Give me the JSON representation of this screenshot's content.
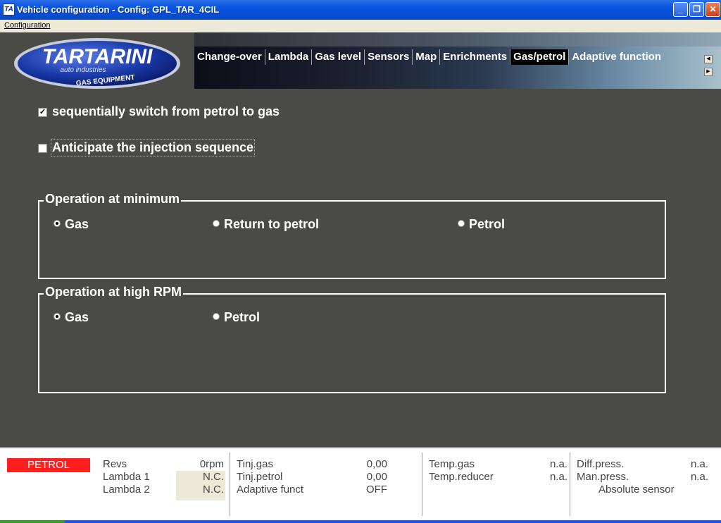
{
  "window": {
    "title": "Vehicle configuration - Config: GPL_TAR_4CIL",
    "icon": "app-icon",
    "controls": [
      "minimize",
      "restore",
      "close"
    ]
  },
  "menubar": {
    "items": [
      "Configuration"
    ]
  },
  "logo": {
    "name": "TARTARINI",
    "tagline": "auto industries",
    "sub": "GAS EQUIPMENT"
  },
  "tabs": [
    "Change-over",
    "Lambda",
    "Gas level",
    "Sensors",
    "Map",
    "Enrichments",
    "Gas/petrol",
    "Adaptive function"
  ],
  "active_tab": "Gas/petrol",
  "options": {
    "sequential_switch": {
      "label": "sequentially switch from petrol to gas",
      "checked": true
    },
    "anticipate": {
      "label": "Anticipate the injection sequence",
      "checked": false
    }
  },
  "groups": {
    "minimum": {
      "title": "Operation at minimum",
      "options": [
        "Gas",
        "Return to petrol",
        "Petrol"
      ],
      "selected": "Gas"
    },
    "high_rpm": {
      "title": "Operation at high RPM",
      "options": [
        "Gas",
        "Petrol"
      ],
      "selected": "Gas"
    }
  },
  "status": {
    "mode": "PETROL",
    "col1": {
      "labels": [
        "Revs",
        "Lambda 1",
        "Lambda 2"
      ],
      "values": [
        "0rpm",
        "N.C.",
        "N.C."
      ]
    },
    "col2": {
      "labels": [
        "Tinj.gas",
        "Tinj.petrol",
        "Adaptive funct"
      ],
      "values": [
        "0,00",
        "0,00",
        "OFF"
      ]
    },
    "col3": {
      "labels": [
        "Temp.gas",
        "Temp.reducer"
      ],
      "values": [
        "n.a.",
        "n.a."
      ]
    },
    "col4": {
      "labels": [
        "Diff.press.",
        "Man.press."
      ],
      "values": [
        "n.a.",
        "n.a."
      ],
      "sensor": "Absolute sensor"
    }
  },
  "colors": {
    "title_bar": "#0a56e0",
    "background": "#4a4a46",
    "petrol_badge": "#ff1f1f",
    "sensor_text": "#008000"
  }
}
